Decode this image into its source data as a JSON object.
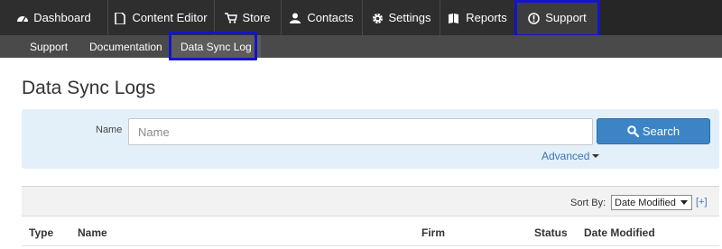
{
  "topnav": {
    "tabs": [
      {
        "label": "Dashboard",
        "icon": "dashboard-icon"
      },
      {
        "label": "Content Editor",
        "icon": "document-icon"
      },
      {
        "label": "Store",
        "icon": "cart-icon"
      },
      {
        "label": "Contacts",
        "icon": "contacts-icon"
      },
      {
        "label": "Settings",
        "icon": "gear-icon"
      },
      {
        "label": "Reports",
        "icon": "reports-icon"
      },
      {
        "label": "Support",
        "icon": "support-icon",
        "active": true
      }
    ]
  },
  "subnav": {
    "items": [
      {
        "label": "Support"
      },
      {
        "label": "Documentation"
      },
      {
        "label": "Data Sync Log",
        "active": true
      }
    ]
  },
  "page": {
    "title": "Data Sync Logs"
  },
  "search": {
    "name_label": "Name",
    "name_placeholder": "Name",
    "name_value": "",
    "search_button": "Search",
    "advanced_link": "Advanced"
  },
  "results": {
    "sort_by_label": "Sort By:",
    "sort_selected": "Date Modified",
    "add_link": "[+]",
    "columns": [
      "Type",
      "Name",
      "Firm",
      "Status",
      "Date Modified"
    ]
  },
  "colors": {
    "highlight": "#1414c8",
    "search_button": "#3c84c6",
    "search_panel": "#e3f0fa",
    "topnav": "#262626"
  }
}
